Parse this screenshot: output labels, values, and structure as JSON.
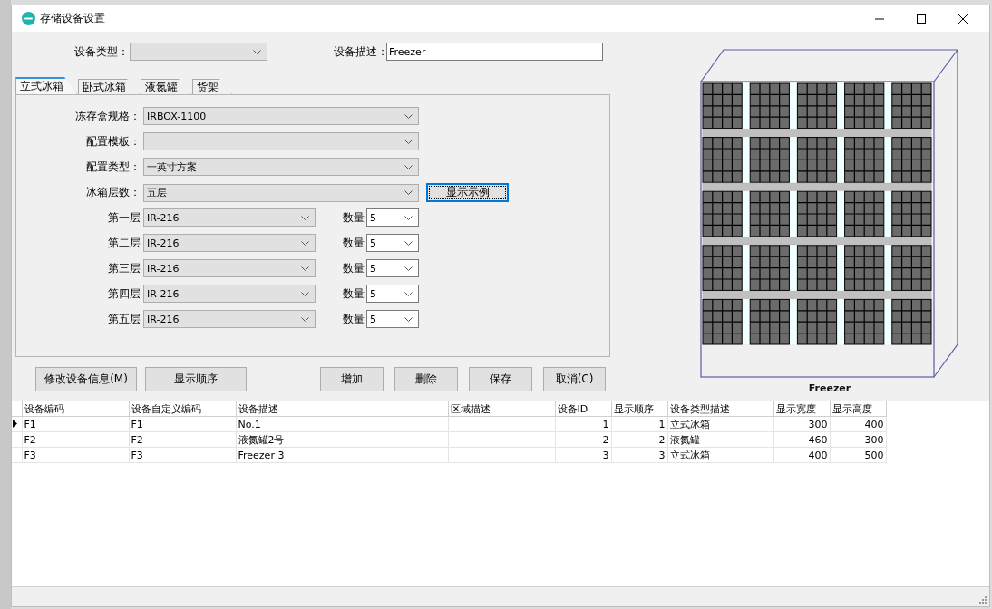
{
  "window": {
    "title": "存储设备设置"
  },
  "device_type": {
    "label": "设备类型："
  },
  "device_description": {
    "label": "设备描述：",
    "value": "Freezer"
  },
  "tabs": [
    {
      "label": "立式冰箱",
      "selected": true
    },
    {
      "label": "卧式冰箱",
      "selected": false
    },
    {
      "label": "液氮罐",
      "selected": false
    },
    {
      "label": "货架",
      "selected": false
    }
  ],
  "fields": [
    {
      "label": "冻存盒规格：",
      "value": "IRBOX-1100"
    },
    {
      "label": "配置模板："
    },
    {
      "label": "配置类型：",
      "value": "一英寸方案"
    },
    {
      "label": "冰箱层数：",
      "value": "五层"
    }
  ],
  "show_example_button": {
    "label": "显示示例",
    "focused": true
  },
  "layers": [
    {
      "label": "第一层",
      "value": "IR-216",
      "quantity_label": "数量",
      "quantity": "5"
    },
    {
      "label": "第二层",
      "value": "IR-216",
      "quantity_label": "数量",
      "quantity": "5"
    },
    {
      "label": "第三层",
      "value": "IR-216",
      "quantity_label": "数量",
      "quantity": "5"
    },
    {
      "label": "第四层",
      "value": "IR-216",
      "quantity_label": "数量",
      "quantity": "5"
    },
    {
      "label": "第五层",
      "value": "IR-216",
      "quantity_label": "数量",
      "quantity": "5"
    }
  ],
  "buttons": [
    {
      "label": "修改设备信息(M)"
    },
    {
      "label": "显示顺序"
    },
    {
      "label": "增加"
    },
    {
      "label": "删除"
    },
    {
      "label": "保存"
    },
    {
      "label": "取消(C)"
    }
  ],
  "preview": {
    "caption": "Freezer"
  },
  "table": {
    "columns": [
      {
        "label": "设备编码",
        "kind": "text"
      },
      {
        "label": "设备自定义编码",
        "kind": "text"
      },
      {
        "label": "设备描述",
        "kind": "text"
      },
      {
        "label": "区域描述",
        "kind": "text"
      },
      {
        "label": "设备ID",
        "kind": "number"
      },
      {
        "label": "显示顺序",
        "kind": "number"
      },
      {
        "label": "设备类型描述",
        "kind": "text"
      },
      {
        "label": "显示宽度",
        "kind": "number"
      },
      {
        "label": "显示高度",
        "kind": "number"
      }
    ],
    "rows": [
      {
        "selected": true,
        "cells": [
          "F1",
          "F1",
          "No.1",
          null,
          "1",
          "1",
          "立式冰箱",
          "300",
          "400"
        ]
      },
      {
        "selected": false,
        "cells": [
          "F2",
          "F2",
          "液氮罐2号",
          null,
          "2",
          "2",
          "液氮罐",
          "460",
          "300"
        ]
      },
      {
        "selected": false,
        "cells": [
          "F3",
          "F3",
          "Freezer 3",
          null,
          "3",
          "3",
          "立式冰箱",
          "400",
          "500"
        ]
      }
    ]
  }
}
